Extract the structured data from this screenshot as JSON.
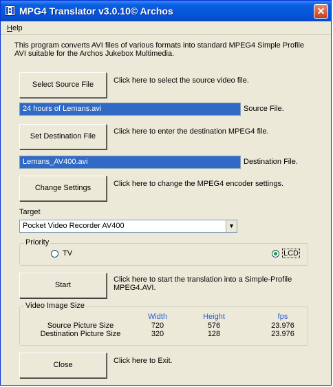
{
  "window": {
    "title": "MPG4 Translator v3.0.10© Archos",
    "close_glyph": "✕"
  },
  "menu": {
    "help": "Help"
  },
  "intro": {
    "line1": "This program converts AVI files of various formats into standard MPEG4 Simple Profile",
    "line2": "AVI suitable for the Archos Jukebox Multimedia."
  },
  "source": {
    "button": "Select Source File",
    "hint": "Click here to select the source video file.",
    "value": "24 hours of Lemans.avi",
    "label": "Source File."
  },
  "destination": {
    "button": "Set Destination File",
    "hint": "Click here to enter the destination MPEG4 file.",
    "value": "Lemans_AV400.avi",
    "label": "Destination File."
  },
  "settings": {
    "button": "Change Settings",
    "hint": "Click here to change the MPEG4 encoder settings."
  },
  "target": {
    "label": "Target",
    "selected": "Pocket Video Recorder AV400"
  },
  "priority": {
    "label": "Priority",
    "tv": "TV",
    "lcd": "LCD",
    "selected": "LCD"
  },
  "start": {
    "button": "Start",
    "hint1": "Click here to start the translation into a Simple-Profile",
    "hint2": "MPEG4.AVI."
  },
  "video_size": {
    "label": "Video Image Size",
    "columns": [
      "Width",
      "Height",
      "fps"
    ],
    "rows": [
      {
        "name": "Source Picture Size",
        "width": "720",
        "height": "576",
        "fps": "23.976"
      },
      {
        "name": "Destination Picture Size",
        "width": "320",
        "height": "128",
        "fps": "23.976"
      }
    ]
  },
  "close": {
    "button": "Close",
    "hint": "Click here to Exit."
  },
  "colors": {
    "titlebar": "#0454d8",
    "selection": "#316ac5",
    "column_header": "#2a5bd0",
    "face": "#ece9d8"
  }
}
